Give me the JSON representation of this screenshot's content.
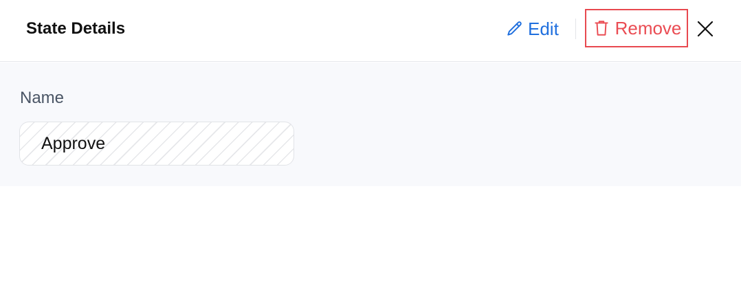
{
  "header": {
    "title": "State Details",
    "edit_label": "Edit",
    "remove_label": "Remove"
  },
  "form": {
    "name_label": "Name",
    "name_value": "Approve"
  },
  "colors": {
    "edit": "#1f6fde",
    "remove": "#ea4c53",
    "body_background": "#f8f9fc"
  },
  "icons": {
    "edit": "pencil-icon",
    "remove": "trash-icon",
    "close": "close-icon"
  }
}
